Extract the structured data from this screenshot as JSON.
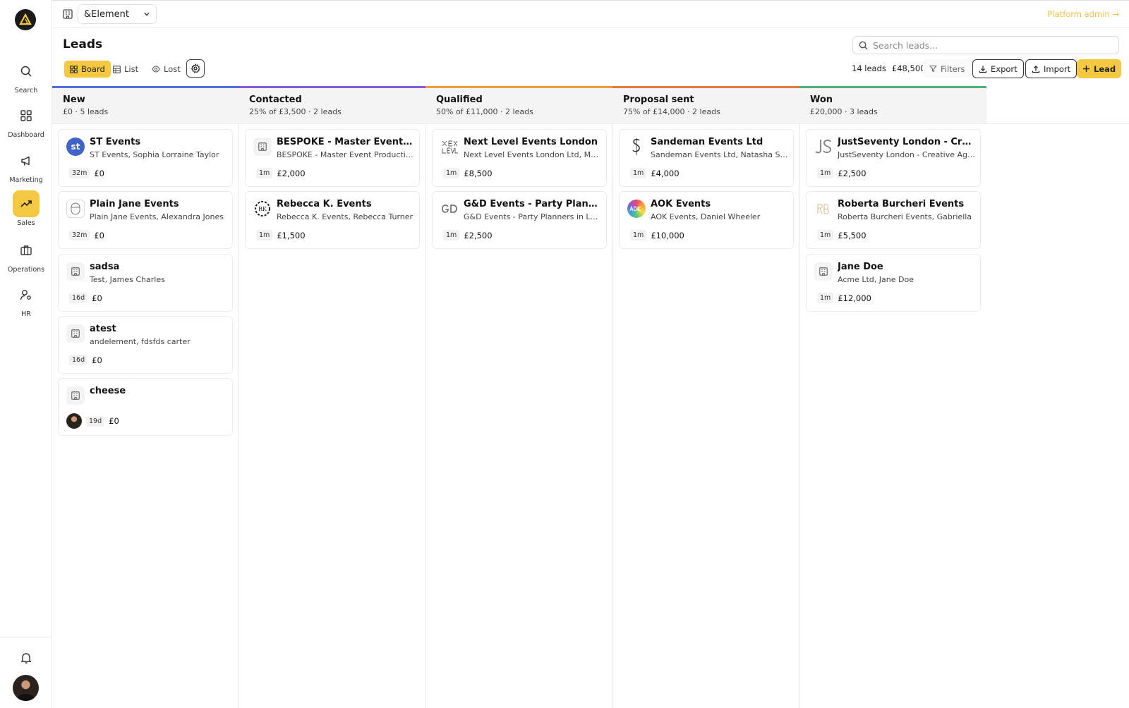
{
  "sidebar": {
    "items": [
      {
        "label": "Search",
        "icon": "search-icon"
      },
      {
        "label": "Dashboard",
        "icon": "dashboard-icon"
      },
      {
        "label": "Marketing",
        "icon": "megaphone-icon"
      },
      {
        "label": "Sales",
        "icon": "trending-up-icon",
        "active": true
      },
      {
        "label": "Operations",
        "icon": "briefcase-icon"
      },
      {
        "label": "HR",
        "icon": "user-cog-icon"
      }
    ]
  },
  "topbar": {
    "org_name": "&Element",
    "platform_admin": "Platform admin →"
  },
  "header": {
    "title": "Leads",
    "search_placeholder": "Search leads...",
    "views": {
      "board": "Board",
      "list": "List",
      "lost": "Lost"
    },
    "lead_count": "14 leads",
    "total_value": "£48,500",
    "filters": "Filters",
    "export": "Export",
    "import": "Import",
    "add_lead": "Lead"
  },
  "colors": {
    "accent": "#f5c842",
    "stage_new": "#4f6fdc",
    "stage_contacted": "#8a5cdc",
    "stage_qualified": "#ef9f3e",
    "stage_proposal": "#e8793a",
    "stage_won": "#4fae7a"
  },
  "columns": [
    {
      "title": "New",
      "subtitle": "£0 · 5 leads",
      "cards": [
        {
          "name": "ST Events",
          "contact": "ST Events, Sophia Lorraine Taylor",
          "age": "32m",
          "value": "£0"
        },
        {
          "name": "Plain Jane Events",
          "contact": "Plain Jane Events, Alexandra Jones",
          "age": "32m",
          "value": "£0"
        },
        {
          "name": "sadsa",
          "contact": "Test, James Charles",
          "age": "16d",
          "value": "£0"
        },
        {
          "name": "atest",
          "contact": "andelement, fdsfds carter",
          "age": "16d",
          "value": "£0"
        },
        {
          "name": "cheese",
          "contact": "",
          "age": "19d",
          "value": "£0"
        }
      ]
    },
    {
      "title": "Contacted",
      "subtitle": "25% of £3,500 · 2 leads",
      "cards": [
        {
          "name": "BESPOKE - Master Event Production",
          "contact": "BESPOKE - Master Event Production",
          "age": "1m",
          "value": "£2,000"
        },
        {
          "name": "Rebecca K. Events",
          "contact": "Rebecca K. Events, Rebecca Turner",
          "age": "1m",
          "value": "£1,500"
        }
      ]
    },
    {
      "title": "Qualified",
      "subtitle": "50% of £11,000 · 2 leads",
      "cards": [
        {
          "name": "Next Level Events London",
          "contact": "Next Level Events London Ltd, Mark",
          "age": "1m",
          "value": "£8,500"
        },
        {
          "name": "G&D Events - Party Planners",
          "contact": "G&D Events - Party Planners in London",
          "age": "1m",
          "value": "£2,500"
        }
      ]
    },
    {
      "title": "Proposal sent",
      "subtitle": "75% of £14,000 · 2 leads",
      "cards": [
        {
          "name": "Sandeman Events Ltd",
          "contact": "Sandeman Events Ltd, Natasha Sandeman",
          "age": "1m",
          "value": "£4,000"
        },
        {
          "name": "AOK Events",
          "contact": "AOK Events, Daniel Wheeler",
          "age": "1m",
          "value": "£10,000"
        }
      ]
    },
    {
      "title": "Won",
      "subtitle": "£20,000 · 3 leads",
      "cards": [
        {
          "name": "JustSeventy London - Creative Agency",
          "contact": "JustSeventy London - Creative Agency",
          "age": "1m",
          "value": "£2,500"
        },
        {
          "name": "Roberta Burcheri Events",
          "contact": "Roberta Burcheri Events, Gabriella",
          "age": "1m",
          "value": "£5,500"
        },
        {
          "name": "Jane Doe",
          "contact": "Acme Ltd, Jane Doe",
          "age": "1m",
          "value": "£12,000"
        }
      ]
    }
  ]
}
